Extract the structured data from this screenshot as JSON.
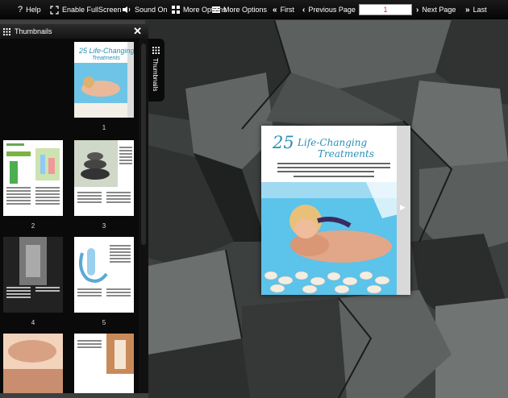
{
  "toolbar": {
    "help": "Help",
    "fullscreen": "Enable FullScreen",
    "sound": "Sound On",
    "more_options_1": "More Options",
    "more_options_2": "More Options",
    "first": "First",
    "previous": "Previous Page",
    "page_value": "1",
    "next": "Next Page",
    "last": "Last"
  },
  "thumbnails": {
    "title": "Thumbnails",
    "tab_label": "Thumbnails",
    "page_numbers": [
      "1",
      "2",
      "3",
      "4",
      "5"
    ]
  },
  "book": {
    "title_number": "25",
    "title_line1": "Life-Changing",
    "title_line2": "Treatments"
  },
  "colors": {
    "accent": "#2a8fb5",
    "page_input_text": "#cc3333"
  }
}
